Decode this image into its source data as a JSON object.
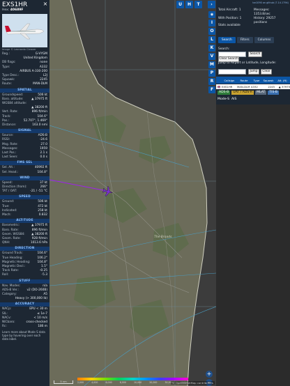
{
  "aircraft": {
    "callsign": "EXS1HR",
    "hex_label": "Hex:",
    "hex": "40689F",
    "photo_credit": "Image © Leonardo Cleaver"
  },
  "details": [
    {
      "k": "Reg.:",
      "v": "G-VYGM"
    },
    {
      "k": "",
      "v": "United Kingdom"
    },
    {
      "k": "DB flags:",
      "v": "none"
    },
    {
      "k": "Type:",
      "v": "A332"
    },
    {
      "k": "",
      "v": "AIRBUS A-330-200"
    },
    {
      "k": "Type Desc.:",
      "v": "L2J"
    },
    {
      "k": "Squawk:",
      "v": "2245"
    },
    {
      "k": "Route:",
      "v": "MAN-DLM"
    }
  ],
  "sections": [
    {
      "title": "SPATIAL",
      "rows": [
        {
          "k": "Groundspeed:",
          "v": "506 kt"
        },
        {
          "k": "Baro. altitude:",
          "v": "▲ 37975 ft"
        },
        {
          "k": "WGS84 altitude:",
          "v": ""
        },
        {
          "k": "",
          "v": "▲ 38200 ft"
        },
        {
          "k": "Vert. Rate:",
          "v": "896 ft/min"
        },
        {
          "k": "Track:",
          "v": "104.6°"
        },
        {
          "k": "Pos.:",
          "v": "52.707°, 1.469°"
        },
        {
          "k": "Distance:",
          "v": "163.0 nmi"
        }
      ]
    },
    {
      "title": "SIGNAL",
      "rows": [
        {
          "k": "Source:",
          "v": "ADS-B"
        },
        {
          "k": "RSSI:",
          "v": "-24.6"
        },
        {
          "k": "Msg. Rate:",
          "v": "27.0"
        },
        {
          "k": "Messages:",
          "v": "1959"
        },
        {
          "k": "Last Pos.:",
          "v": "2.1 s"
        },
        {
          "k": "Last Seen:",
          "v": "0.0 s"
        }
      ]
    },
    {
      "title": "FMS SEL",
      "rows": [
        {
          "k": "Sel. Alt.:",
          "v": "40992 ft"
        },
        {
          "k": "Sel. Head.:",
          "v": "104.8°"
        }
      ]
    },
    {
      "title": "WIND",
      "rows": [
        {
          "k": "Speed:",
          "v": "37 kt"
        },
        {
          "k": "Direction (from):",
          "v": "266°"
        },
        {
          "k": "TAT / OAT:",
          "v": "-21 / -51 °C"
        }
      ]
    },
    {
      "title": "SPEED",
      "rows": [
        {
          "k": "Ground:",
          "v": "506 kt"
        },
        {
          "k": "True:",
          "v": "472 kt"
        },
        {
          "k": "Indicated:",
          "v": "258 kt"
        },
        {
          "k": "Mach:",
          "v": "0.832"
        }
      ]
    },
    {
      "title": "ALTITUDE",
      "rows": [
        {
          "k": "Barometric:",
          "v": "▲ 37975 ft"
        },
        {
          "k": "Baro. Rate:",
          "v": "896 ft/min"
        },
        {
          "k": "Geom. WGS84:",
          "v": "▲ 38200 ft"
        },
        {
          "k": "Geom. Rate:",
          "v": "928 ft/min"
        },
        {
          "k": "QNH:",
          "v": "1013.6 hPa"
        }
      ]
    },
    {
      "title": "DIRECTION",
      "rows": [
        {
          "k": "Ground Track:",
          "v": "104.6°"
        },
        {
          "k": "True Heading:",
          "v": "106.2°"
        },
        {
          "k": "Magnetic Heading:",
          "v": "104.8°"
        },
        {
          "k": "Magnetic Decl.:",
          "v": "1.5°"
        },
        {
          "k": "Track Rate:",
          "v": "-0.25"
        },
        {
          "k": "Roll:",
          "v": "-5.3"
        }
      ]
    },
    {
      "title": "STUFF",
      "rows": [
        {
          "k": "Nav. Modes:",
          "v": "n/a"
        },
        {
          "k": "ADS-B Ver.:",
          "v": "v2 (DO-260B)"
        },
        {
          "k": "Category:",
          "v": "A5"
        },
        {
          "k": "",
          "v": "Heavy (> 300,000 lb)"
        }
      ]
    },
    {
      "title": "ACCURACY",
      "rows": [
        {
          "k": "NACp:",
          "v": "EPU < 30 m"
        },
        {
          "k": "SIL:",
          "v": "≤ 1e-7"
        },
        {
          "k": "NACv:",
          "v": "< 10 m/s"
        },
        {
          "k": "NICbaro:",
          "v": "cross-checked"
        },
        {
          "k": "Rc:",
          "v": "186 m"
        }
      ]
    }
  ],
  "footer": "Learn more about Mode S data type by hovering over each data label.",
  "map": {
    "top_buttons": [
      "U",
      "H",
      "T"
    ],
    "side_buttons": [
      "◉",
      "I",
      "O",
      "L",
      "K",
      "V",
      "M",
      "P",
      "R",
      "F"
    ],
    "zoom_in": "+",
    "zoom_out": "−",
    "attribution": "© OpenStreetMap contributors",
    "scale_label": "5 nm",
    "legend_labels": [
      "2,000",
      "4,000",
      "6,000",
      "8,000",
      "10,000",
      "20,000",
      "30,000",
      "40,000"
    ],
    "place_labels": [
      "The Broads"
    ],
    "track_color": "#a020f0",
    "plane_color": "#7b2fd0"
  },
  "stats": {
    "build": "tar1090 on github (7.14.1794)",
    "total_aircraft": "Total Aircraft: 1",
    "with_position": "With Position: 1",
    "stats_available": "Stats available",
    "messages": "Messages:",
    "msg_rate": "1353.8/sec",
    "history": "History: 29257",
    "positions": "positions"
  },
  "tabs": [
    "Search",
    "Filters",
    "Columns"
  ],
  "search": {
    "label": "Search:",
    "placeholder": "",
    "search_button": "Search",
    "clear_button": "Clear Search",
    "jump_label": "Jump to Airport or Latitude, Longitude:",
    "jump_button": "Jump",
    "clear2_button": "Clear"
  },
  "table": {
    "columns": [
      "",
      "Callsign",
      "Route",
      "Type",
      "Squawk",
      "Alt. (ft)"
    ],
    "rows": [
      {
        "flag": "🇬🇧",
        "callsign": "EXS1HR",
        "route": "MAN-DLM",
        "type": "A332",
        "squawk": "2245",
        "alt": "▲ 37975"
      }
    ]
  },
  "badges": [
    "ADS-B",
    "UAT / ADS-R",
    "MLAT",
    "TIS-B"
  ],
  "modes": [
    "Mode-S",
    "AIS"
  ]
}
